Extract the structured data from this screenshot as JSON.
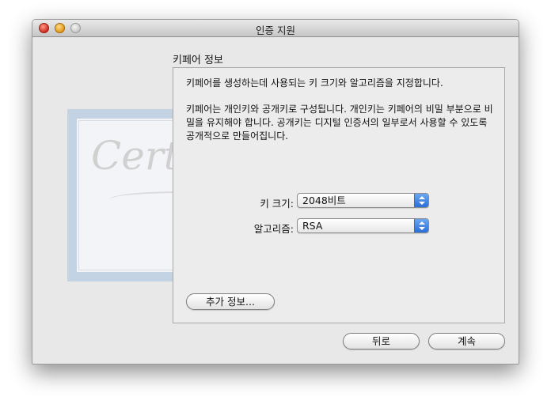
{
  "window": {
    "title": "인증 지원"
  },
  "section": {
    "title": "키페어 정보"
  },
  "panel": {
    "description_1": "키페어를 생성하는데 사용되는 키 크기와 알고리즘을 지정합니다.",
    "description_2": "키페어는 개인키와 공개키로 구성됩니다. 개인키는 키페어의 비밀 부분으로 비밀을 유지해야 합니다. 공개키는 디지털 인증서의 일부로서 사용할 수 있도록 공개적으로 만들어집니다.",
    "key_size": {
      "label": "키 크기:",
      "value": "2048비트"
    },
    "algorithm": {
      "label": "알고리즘:",
      "value": "RSA"
    },
    "more_info_label": "추가 정보..."
  },
  "buttons": {
    "back_label": "뒤로",
    "continue_label": "계속"
  },
  "background_art": {
    "script_text": "Certificate"
  },
  "colors": {
    "popup_arrow_blue": "#2b6fd6",
    "close_red": "#d12b1e",
    "minimize_yellow": "#e09a14"
  }
}
